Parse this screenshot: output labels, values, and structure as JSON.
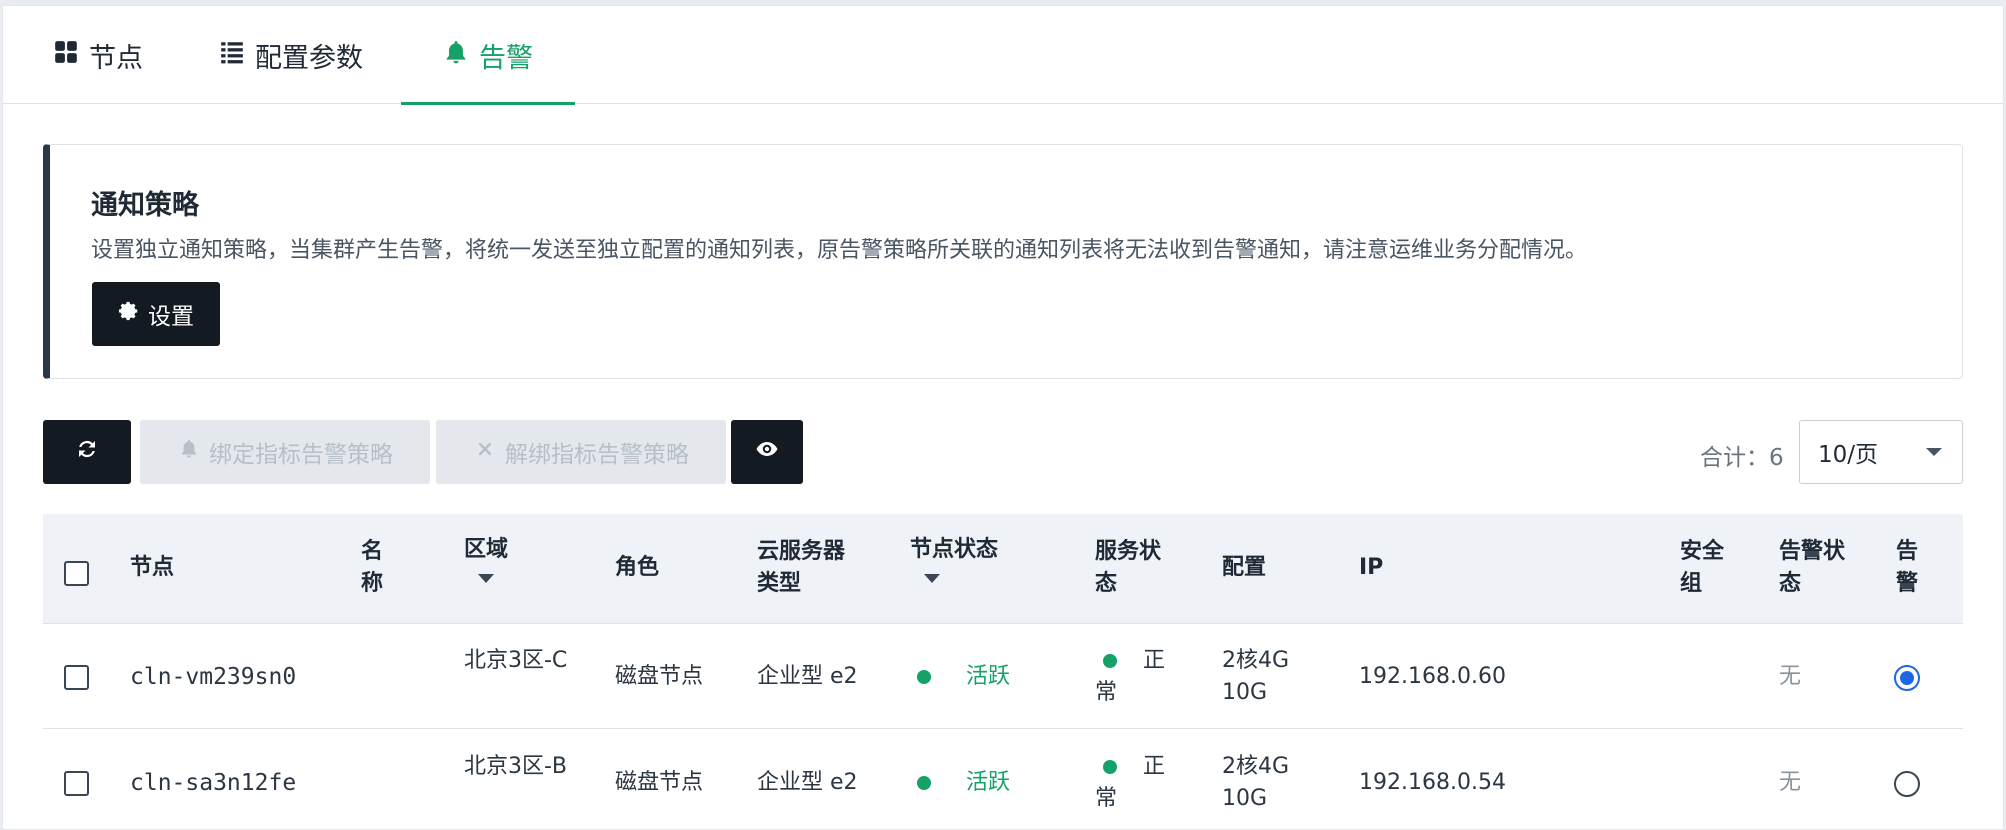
{
  "tabs": [
    {
      "label": "节点",
      "icon": "grid-icon"
    },
    {
      "label": "配置参数",
      "icon": "list-icon"
    },
    {
      "label": "告警",
      "icon": "bell-icon"
    }
  ],
  "active_tab": "告警",
  "notice": {
    "title": "通知策略",
    "description": "设置独立通知策略，当集群产生告警，将统一发送至独立配置的通知列表，原告警策略所关联的通知列表将无法收到告警通知，请注意运维业务分配情况。",
    "button_label": "设置"
  },
  "toolbar": {
    "bind_label": "绑定指标告警策略",
    "unbind_label": "解绑指标告警策略",
    "total_text": "合计：6",
    "page_size": "10/页"
  },
  "table": {
    "headers": {
      "node": "节点",
      "name": "名称",
      "zone": "区域",
      "role": "角色",
      "instance_type": "云服务器类型",
      "node_status": "节点状态",
      "service_status": "服务状态",
      "config": "配置",
      "ip": "IP",
      "security_group": "安全组",
      "alarm_status": "告警状态",
      "alarm": "告警"
    },
    "rows": [
      {
        "node": "cln-vm239sn0",
        "name": "",
        "zone": "北京3区-C",
        "role": "磁盘节点",
        "instance_type": "企业型 e2",
        "node_status": "活跃",
        "service_status": "正常",
        "config": "2核4G 10G",
        "ip": "192.168.0.60",
        "security_group": "",
        "alarm_status": "无",
        "alarm_selected": true
      },
      {
        "node": "cln-sa3n12fe",
        "name": "",
        "zone": "北京3区-B",
        "role": "磁盘节点",
        "instance_type": "企业型 e2",
        "node_status": "活跃",
        "service_status": "正常",
        "config": "2核4G 10G",
        "ip": "192.168.0.54",
        "security_group": "",
        "alarm_status": "无",
        "alarm_selected": false
      }
    ]
  },
  "colors": {
    "accent_green": "#15a167",
    "dark_button": "#131a21",
    "radio_blue": "#1f66e5"
  }
}
